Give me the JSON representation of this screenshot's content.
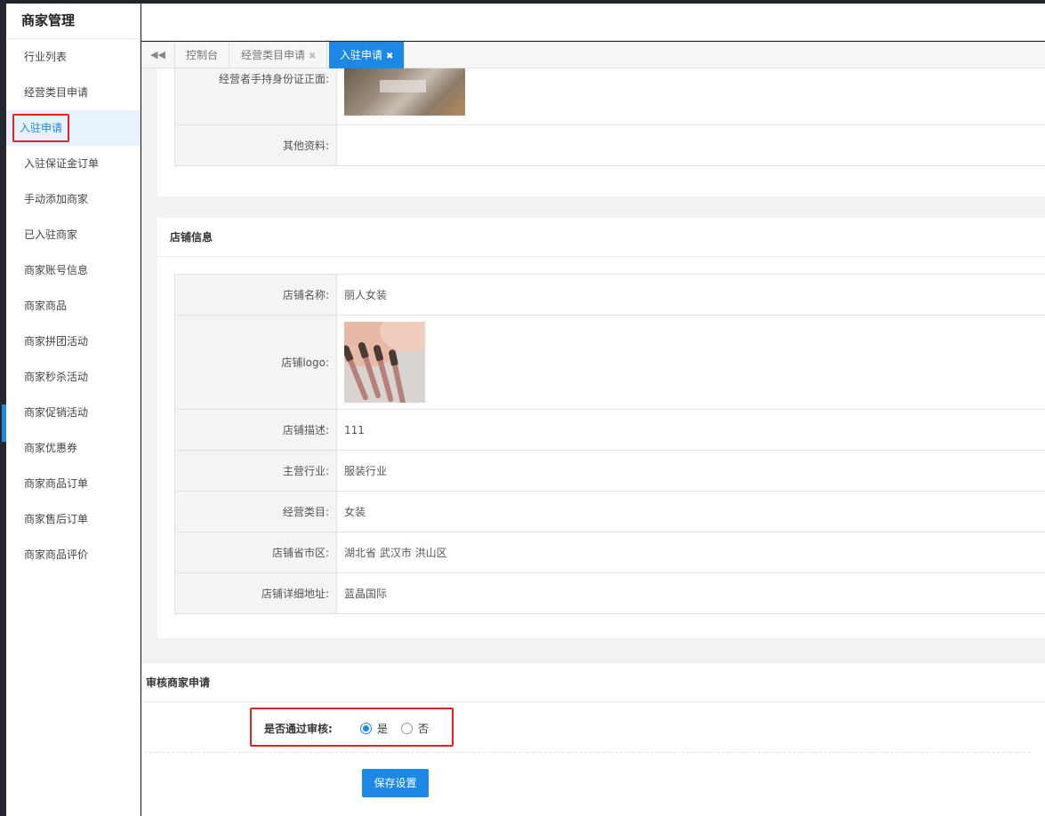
{
  "colors": {
    "accent": "#1e88e5",
    "highlight": "#e02222",
    "sidebar_bg": "#ffffff",
    "dark_chrome": "#1f2429"
  },
  "sidebar": {
    "title": "商家管理",
    "items": [
      {
        "label": "行业列表"
      },
      {
        "label": "经营类目申请"
      },
      {
        "label": "入驻申请",
        "active": true
      },
      {
        "label": "入驻保证金订单"
      },
      {
        "label": "手动添加商家"
      },
      {
        "label": "已入驻商家"
      },
      {
        "label": "商家账号信息"
      },
      {
        "label": "商家商品"
      },
      {
        "label": "商家拼团活动"
      },
      {
        "label": "商家秒杀活动"
      },
      {
        "label": "商家促销活动"
      },
      {
        "label": "商家优惠券"
      },
      {
        "label": "商家商品订单"
      },
      {
        "label": "商家售后订单"
      },
      {
        "label": "商家商品评价"
      }
    ]
  },
  "tabs": {
    "back_icon": "double-chevron-left-icon",
    "items": [
      {
        "label": "控制台",
        "closable": false
      },
      {
        "label": "经营类目申请",
        "closable": true
      },
      {
        "label": "入驻申请",
        "closable": true,
        "active": true
      }
    ],
    "close_glyph": "✖"
  },
  "top_section": {
    "rows": [
      {
        "label": "经营者手持身份证正面:",
        "value_type": "image",
        "image": "id-card-photo"
      },
      {
        "label": "其他资料:",
        "value": ""
      }
    ]
  },
  "shop_info": {
    "title": "店铺信息",
    "rows": [
      {
        "label": "店铺名称:",
        "value": "丽人女装"
      },
      {
        "label": "店铺logo:",
        "value_type": "image",
        "image": "makeup-brushes-logo"
      },
      {
        "label": "店铺描述:",
        "value": "111"
      },
      {
        "label": "主营行业:",
        "value": "服装行业"
      },
      {
        "label": "经营类目:",
        "value": "女装"
      },
      {
        "label": "店铺省市区:",
        "value": "湖北省 武汉市 洪山区"
      },
      {
        "label": "店铺详细地址:",
        "value": "蓝晶国际"
      }
    ]
  },
  "review": {
    "title": "审核商家申请",
    "question": "是否通过审核:",
    "options": [
      {
        "label": "是",
        "selected": true
      },
      {
        "label": "否",
        "selected": false
      }
    ],
    "save_label": "保存设置"
  }
}
